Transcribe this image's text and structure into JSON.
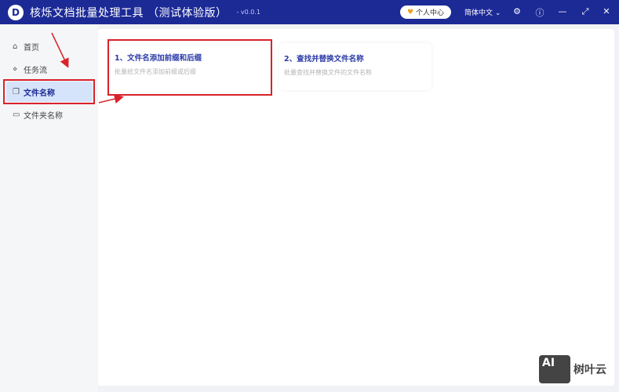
{
  "titlebar": {
    "logo_letter": "D",
    "title": "核烁文档批量处理工具 （测试体验版）",
    "version": "- v0.0.1",
    "user_center": "个人中心",
    "language": "简体中文",
    "icons": [
      "gear-icon",
      "help-icon",
      "minimize-icon",
      "maximize-icon",
      "close-icon"
    ]
  },
  "sidebar": {
    "items": [
      {
        "label": "首页",
        "icon": "home-icon"
      },
      {
        "label": "任务流",
        "icon": "workflow-icon"
      },
      {
        "label": "文件名称",
        "icon": "file-icon",
        "active": true
      },
      {
        "label": "文件夹名称",
        "icon": "folder-icon"
      }
    ]
  },
  "cards": [
    {
      "title": "1、文件名添加前缀和后缀",
      "desc": "批量给文件名添加前缀或后缀"
    },
    {
      "title": "2、查找并替换文件名称",
      "desc": "批量查找并替换文件的文件名称"
    }
  ],
  "watermark": {
    "logo": "AI",
    "text": "树叶云"
  },
  "colors": {
    "titlebar": "#1c2a96",
    "accent": "#2b3aa8",
    "annotation": "#d9222a",
    "active_bg": "#d6e4fb"
  }
}
